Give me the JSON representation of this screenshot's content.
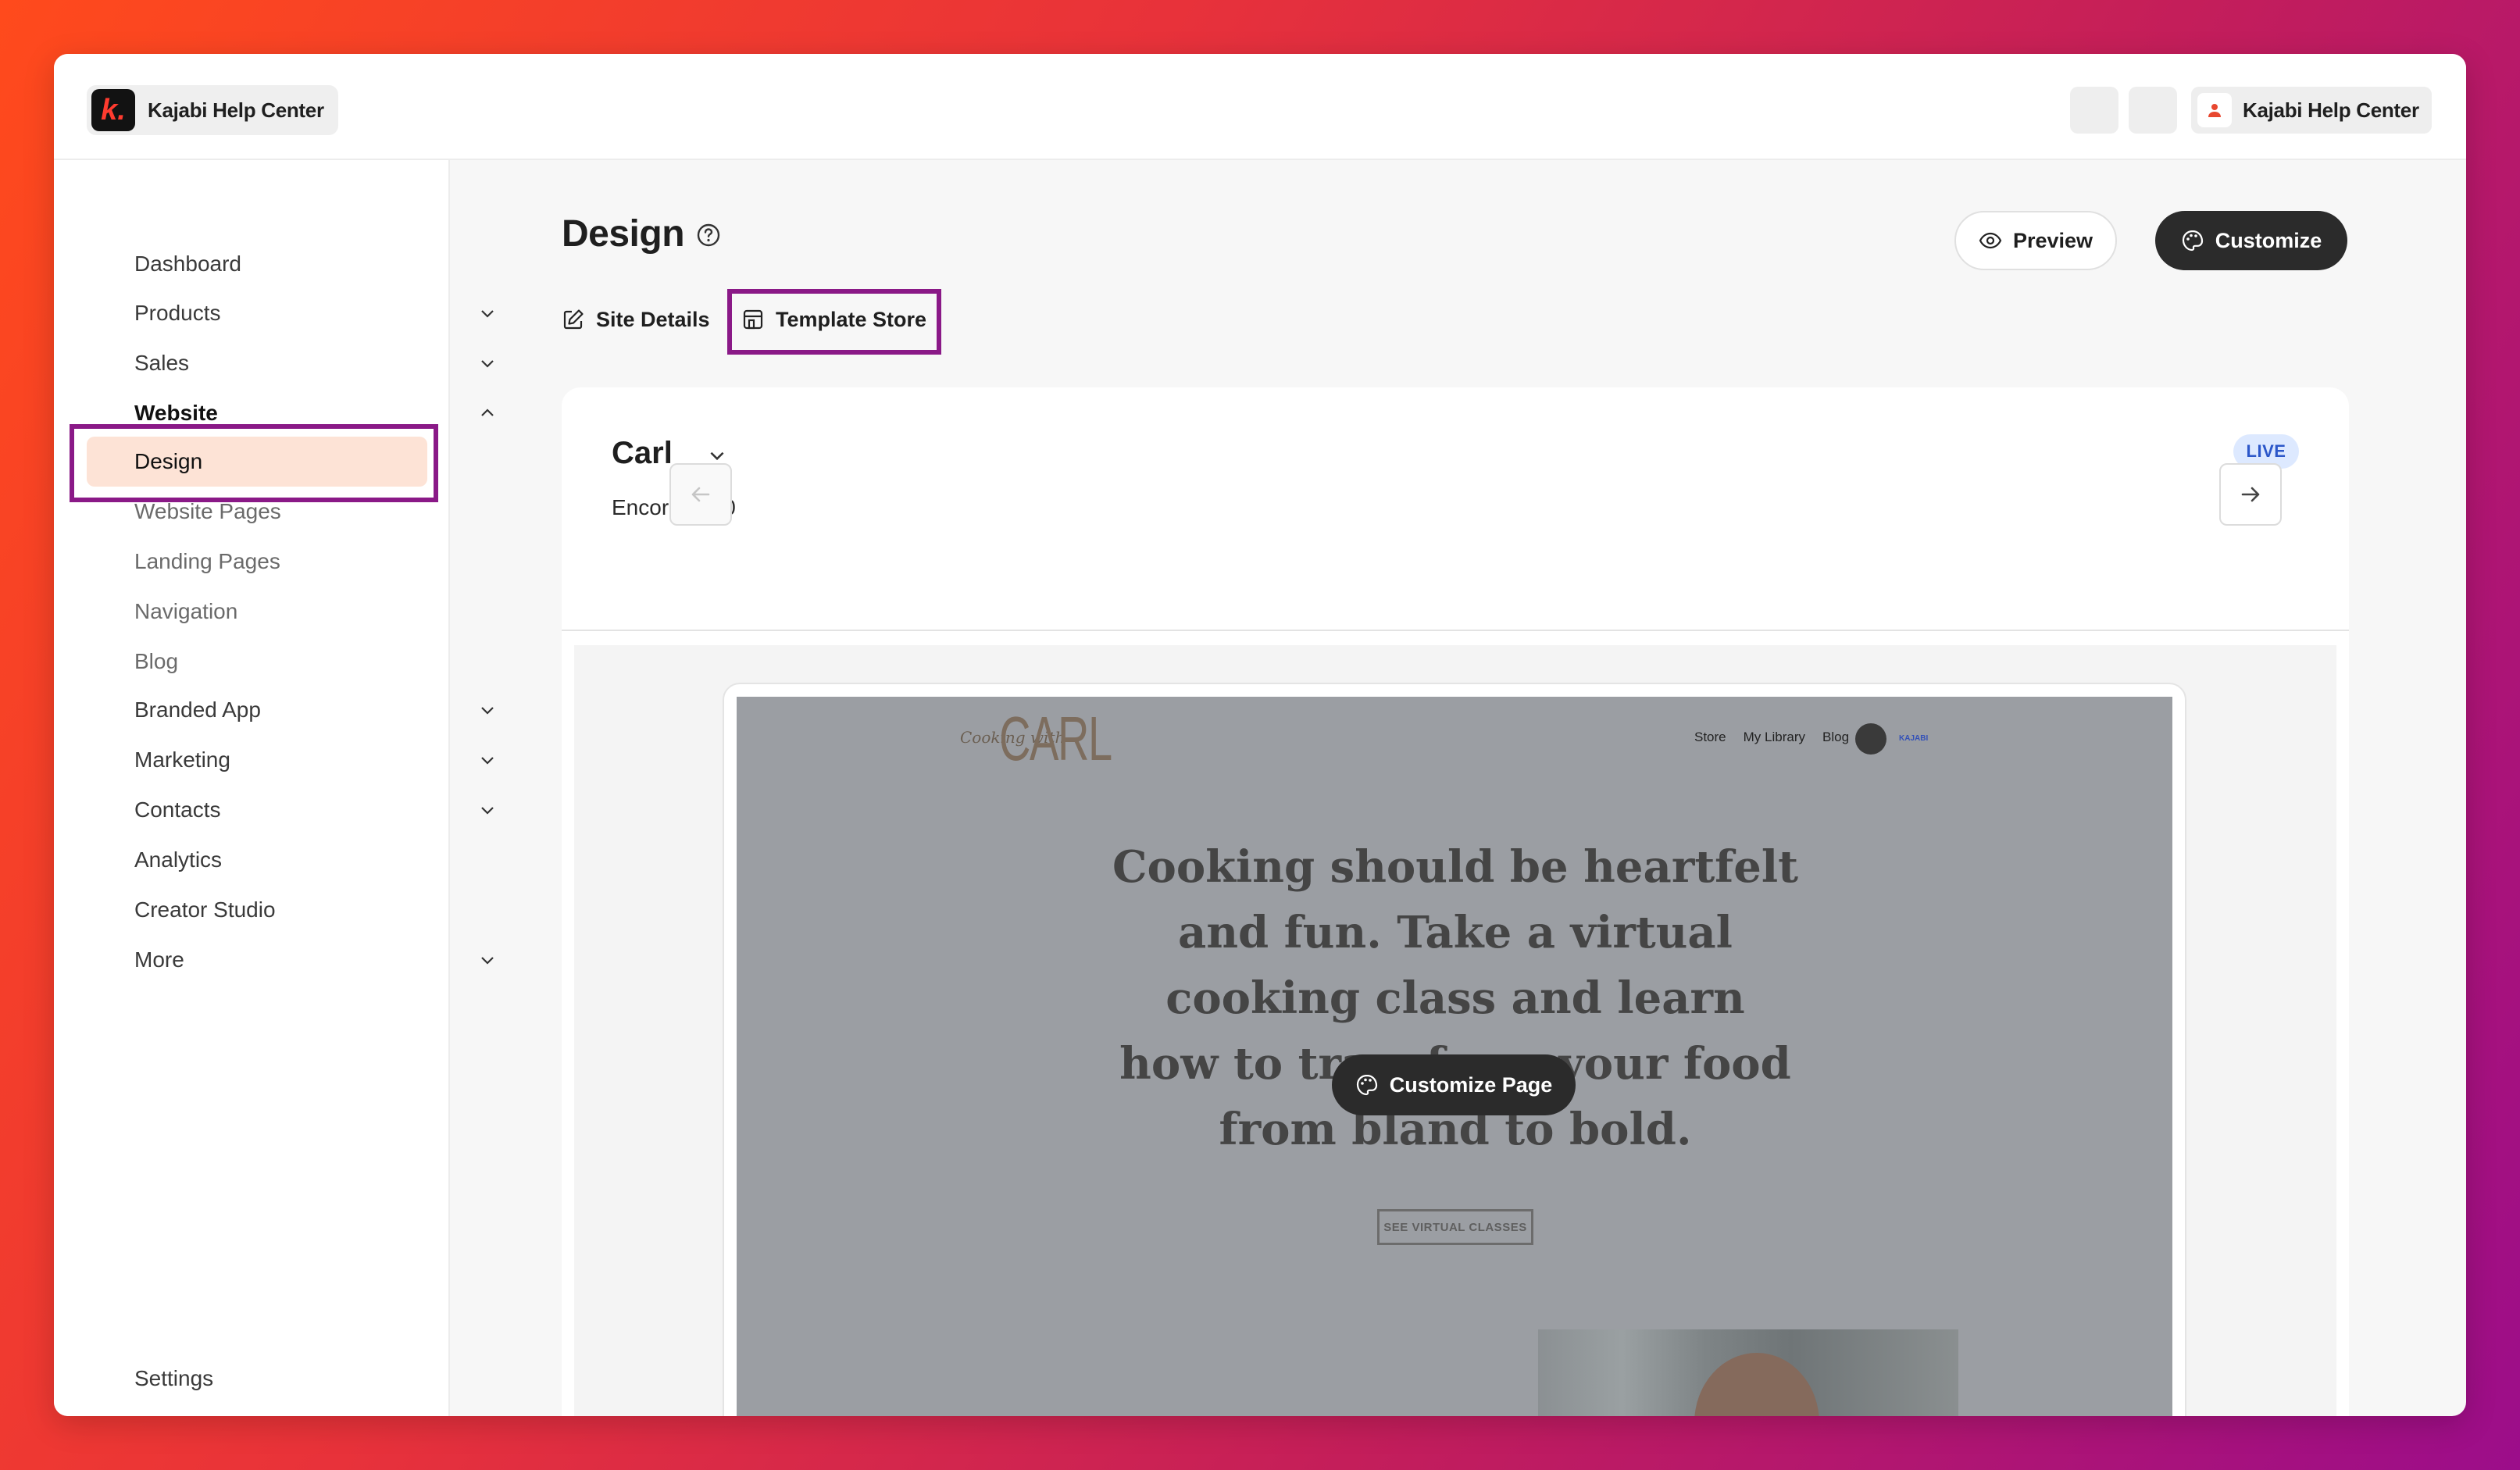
{
  "brand": {
    "name": "Kajabi Help Center",
    "logo_letter": "k."
  },
  "account": {
    "name": "Kajabi Help Center"
  },
  "sidebar": {
    "items": [
      {
        "label": "Dashboard",
        "expandable": false
      },
      {
        "label": "Products",
        "expandable": true
      },
      {
        "label": "Sales",
        "expandable": true
      },
      {
        "label": "Website",
        "expandable": true,
        "expanded": true
      },
      {
        "label": "Design",
        "sub": true,
        "active": true
      },
      {
        "label": "Website Pages",
        "sub": true
      },
      {
        "label": "Landing Pages",
        "sub": true
      },
      {
        "label": "Navigation",
        "sub": true
      },
      {
        "label": "Blog",
        "sub": true
      },
      {
        "label": "Branded App",
        "expandable": true
      },
      {
        "label": "Marketing",
        "expandable": true
      },
      {
        "label": "Contacts",
        "expandable": true
      },
      {
        "label": "Analytics",
        "expandable": false
      },
      {
        "label": "Creator Studio",
        "expandable": false
      },
      {
        "label": "More",
        "expandable": true
      }
    ],
    "settings_label": "Settings"
  },
  "page": {
    "title": "Design",
    "preview_label": "Preview",
    "customize_label": "Customize"
  },
  "tabs": {
    "site_details": "Site Details",
    "template_store": "Template Store"
  },
  "theme": {
    "name": "Carl",
    "version": "Encore 1.8.0",
    "status": "LIVE"
  },
  "site_preview": {
    "script_text": "Cooking with",
    "logo_text": "CARL",
    "nav": [
      "Store",
      "My Library",
      "Blog"
    ],
    "badge": "KAJABI",
    "headline": "Cooking should be heartfelt and fun. Take a virtual cooking class and learn how to transform your food from bland to bold.",
    "cta": "SEE VIRTUAL CLASSES",
    "customize_page_label": "Customize Page"
  },
  "colors": {
    "accent_active_bg": "#fde3d6",
    "highlight_box": "#8a1987",
    "primary_button": "#2b2b2b",
    "live_badge_bg": "#dde9ff",
    "live_badge_text": "#2c57c9"
  }
}
